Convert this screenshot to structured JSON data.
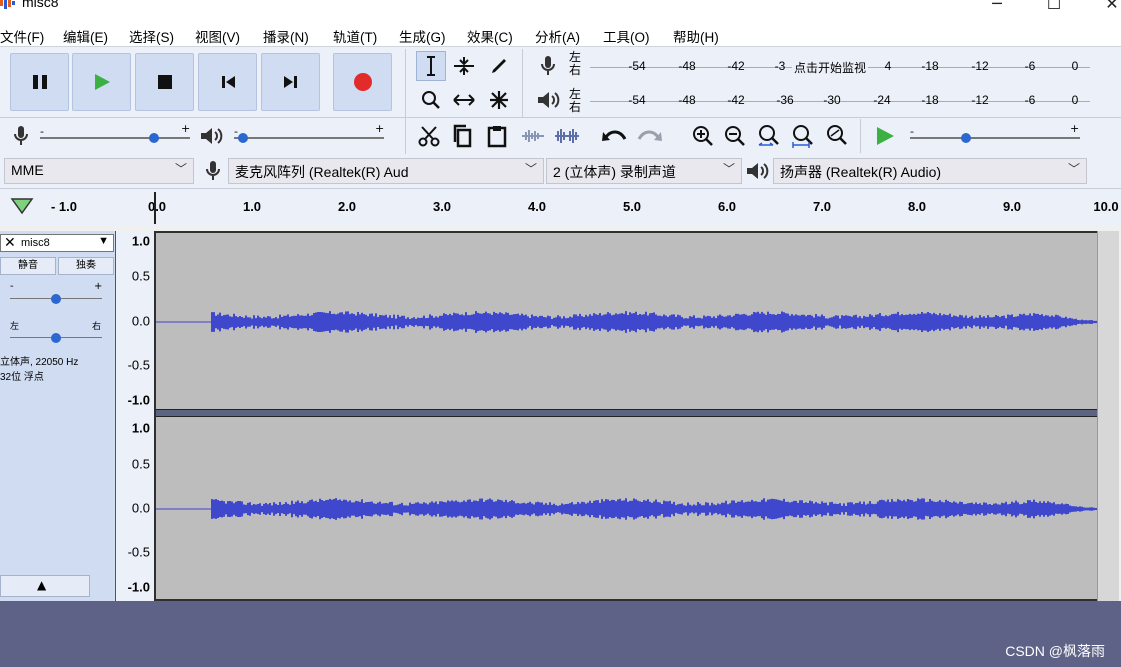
{
  "window": {
    "title": "misc8"
  },
  "menu": {
    "items": [
      "文件(F)",
      "编辑(E)",
      "选择(S)",
      "视图(V)",
      "播录(N)",
      "轨道(T)",
      "生成(G)",
      "效果(C)",
      "分析(A)",
      "工具(O)",
      "帮助(H)"
    ]
  },
  "transport": {
    "buttons": [
      "pause-icon",
      "play-icon",
      "stop-icon",
      "skip-start-icon",
      "skip-end-icon",
      "record-icon"
    ]
  },
  "tools": {
    "row1": [
      "selection-tool-icon",
      "envelope-tool-icon",
      "draw-tool-icon"
    ],
    "row2": [
      "zoom-tool-icon",
      "timeshift-tool-icon",
      "multi-tool-icon"
    ]
  },
  "meters": {
    "record_ticks": [
      "-54",
      "-48",
      "-42",
      "-3",
      "4",
      "-18",
      "-12",
      "-6",
      "0"
    ],
    "record_prompt": "点击开始监视",
    "play_ticks": [
      "-54",
      "-48",
      "-42",
      "-36",
      "-30",
      "-24",
      "-18",
      "-12",
      "-6",
      "0"
    ],
    "lr_top": "左",
    "lr_bottom": "右"
  },
  "mixer": {
    "record_volume": 0.95,
    "playback_volume": 0.06,
    "play_at_speed": 0.33
  },
  "devices": {
    "host": "MME",
    "input": "麦克风阵列 (Realtek(R) Aud",
    "channels": "2 (立体声) 录制声道",
    "output": "扬声器 (Realtek(R) Audio)"
  },
  "timeline": {
    "labels": [
      "- 1.0",
      "0.0",
      "1.0",
      "2.0",
      "3.0",
      "4.0",
      "5.0",
      "6.0",
      "7.0",
      "8.0",
      "9.0",
      "10.0"
    ]
  },
  "track": {
    "name": "misc8",
    "mute": "静音",
    "solo": "独奏",
    "gain_minus": "-",
    "gain_plus": "+",
    "pan_left": "左",
    "pan_right": "右",
    "info_line1": "立体声, 22050 Hz",
    "info_line2": "32位 浮点",
    "collapse_icon": "collapse-arrow-icon",
    "gain": 0.5,
    "pan": 0.5
  },
  "ruler": {
    "labels": [
      "1.0",
      "0.5",
      "0.0",
      "-0.5",
      "-1.0"
    ]
  },
  "colors": {
    "waveform": "#3f48cc",
    "background": "#bdbdbd",
    "record_red": "#e22b2b",
    "play_green": "#3cb043"
  },
  "watermark": "CSDN @枫落雨"
}
